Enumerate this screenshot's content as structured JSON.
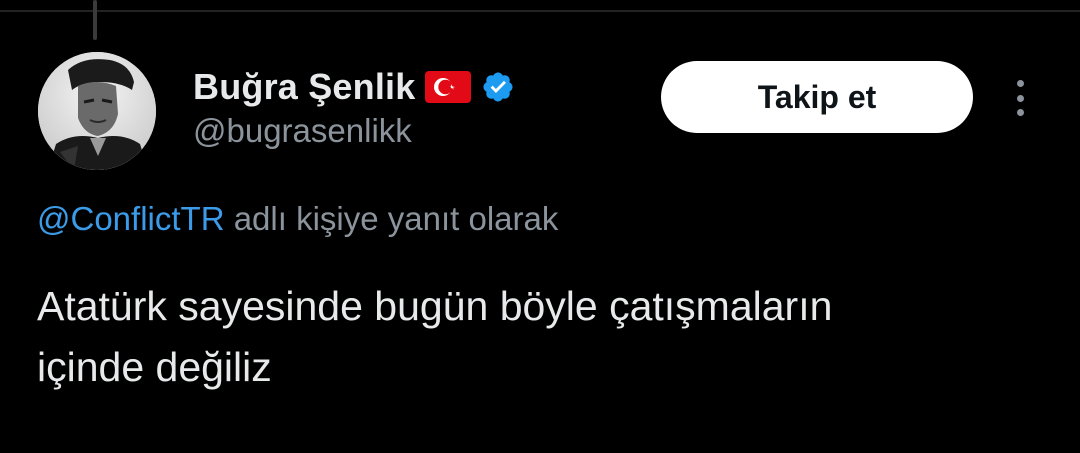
{
  "author": {
    "display_name": "Buğra Şenlik",
    "handle": "@bugrasenlikk",
    "avatar": "avatar-portrait",
    "flag_icon": "turkey-flag-icon",
    "verified_icon": "verified-badge-icon"
  },
  "actions": {
    "follow_label": "Takip et",
    "more_icon": "more-options-icon"
  },
  "reply_context": {
    "mention": "@ConflictTR",
    "text": "adlı kişiye yanıt olarak"
  },
  "tweet": {
    "line1": "Atatürk sayesinde bugün böyle çatışmaların",
    "line2": "içinde değiliz"
  },
  "colors": {
    "background": "#000000",
    "text": "#e7e9ea",
    "muted": "#8b949c",
    "link": "#3b9be8",
    "verified": "#1d9bf0",
    "flag_red": "#e30a17",
    "button_bg": "#ffffff"
  }
}
